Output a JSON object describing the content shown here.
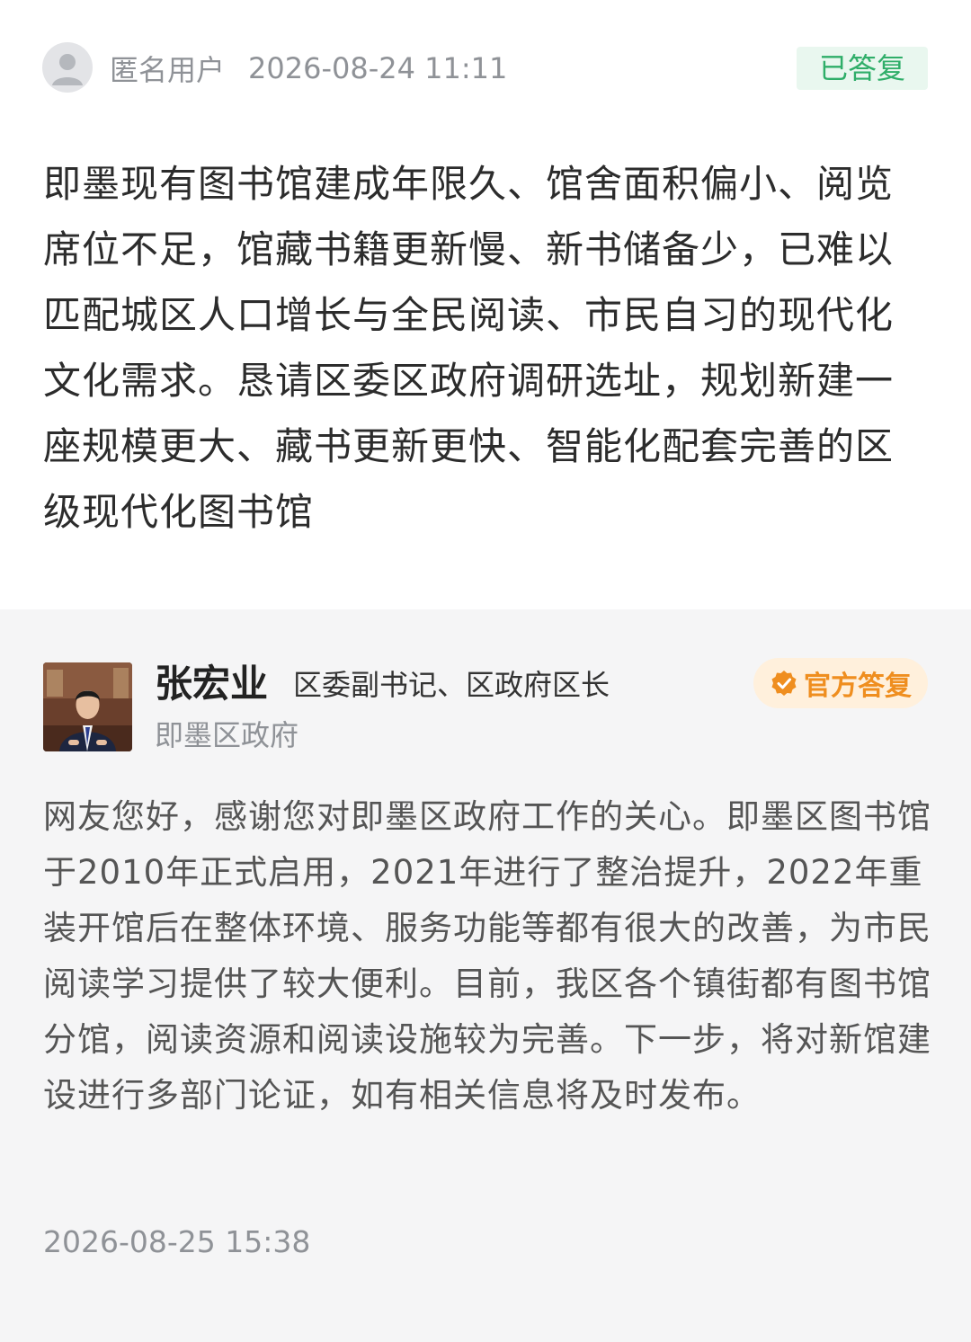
{
  "question": {
    "user_name": "匿名用户",
    "timestamp": "2026-08-24 11:11",
    "status": "已答复",
    "avatar_icon": "anonymous-user-icon",
    "text": "即墨现有图书馆建成年限久、馆舍面积偏小、阅览席位不足，馆藏书籍更新慢、新书储备少，已难以匹配城区人口增长与全民阅读、市民自习的现代化文化需求。恳请区委区政府调研选址，规划新建一座规模更大、藏书更新更快、智能化配套完善的区级现代化图书馆"
  },
  "reply": {
    "official_name": "张宏业",
    "official_title": "区委副书记、区政府区长",
    "organization": "即墨区政府",
    "badge": "官方答复",
    "badge_icon": "verified-check-icon",
    "text": "网友您好，感谢您对即墨区政府工作的关心。即墨区图书馆于2010年正式启用，2021年进行了整治提升，2022年重装开馆后在整体环境、服务功能等都有很大的改善，为市民阅读学习提供了较大便利。目前，我区各个镇街都有图书馆分馆，阅读资源和阅读设施较为完善。下一步，将对新馆建设进行多部门论证，如有相关信息将及时发布。",
    "timestamp": "2026-08-25 15:38"
  },
  "colors": {
    "status_green": "#2fae69",
    "status_green_bg": "#e9f7ef",
    "badge_orange": "#ef8e1f",
    "badge_orange_bg": "#fff0dc",
    "reply_bg": "#f5f5f6"
  }
}
